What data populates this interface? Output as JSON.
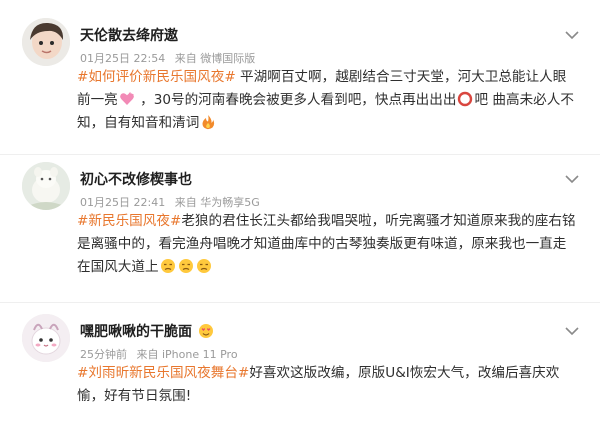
{
  "comments": [
    {
      "username": "天伦散去绛府遨",
      "date": "01月25日 22:54",
      "source": "来自 微博国际版",
      "topic": "#如何评价新民乐国风夜#",
      "text_a": " 平湖啊百丈啊，越剧结合三寸天堂，河大卫总能让人眼前一亮",
      "text_b": " ，30号的河南春晚会被更多人看到吧，快点再出出出",
      "text_c": "吧 曲高未必人不知，自有知音和清词",
      "emoji_1": "heart-emoji",
      "emoji_2": "circle-emoji",
      "emoji_3": "fire-emoji"
    },
    {
      "username": "初心不改修楔事也",
      "date": "01月25日 22:41",
      "source": "来自 华为畅享5G",
      "topic": "#新民乐国风夜#",
      "text_a": "老狼的君住长江头都给我唱哭啦，听完离骚才知道原来我的座右铭是离骚中的，看完渔舟唱晚才知道曲库中的古琴独奏版更有味道，原来我也一直走在国风大道上",
      "emoji": "sad-face-emoji"
    },
    {
      "username": "嘿肥啾啾的干脆面",
      "date": "25分钟前",
      "source": "来自 iPhone 11 Pro",
      "topic": "#刘雨昕新民乐国风夜舞台#",
      "text_a": "好喜欢这版改编，原版U&I恢宏大气，改编后喜庆欢愉，好有节日氛围!",
      "badge_emoji": "love-face-emoji"
    }
  ],
  "icons": {
    "expand": "chevron-down-icon"
  },
  "colors": {
    "topic": "#e8772e",
    "meta": "#9a9a9a"
  }
}
